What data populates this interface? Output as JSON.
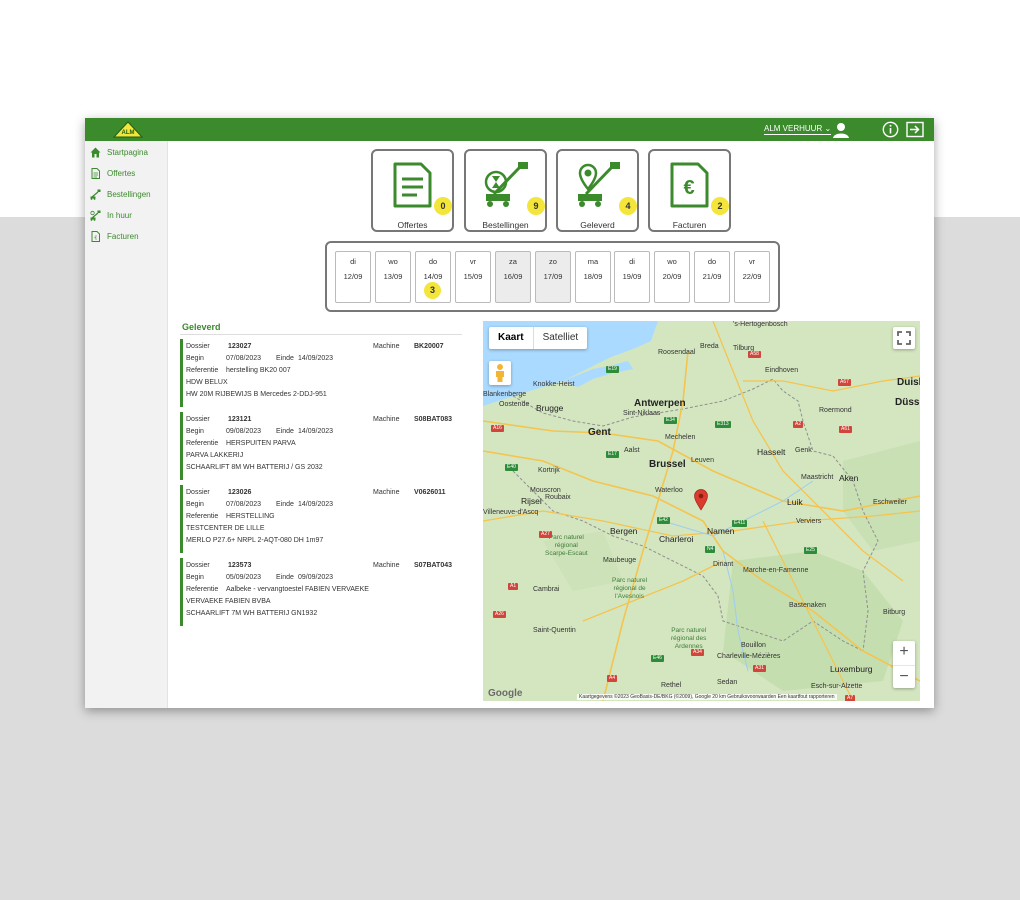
{
  "header": {
    "user_label": "ALM VERHUUR ⌄"
  },
  "sidebar": {
    "items": [
      {
        "label": "Startpagina",
        "icon": "home-icon"
      },
      {
        "label": "Offertes",
        "icon": "document-icon"
      },
      {
        "label": "Bestellingen",
        "icon": "lift-order-icon"
      },
      {
        "label": "In huur",
        "icon": "lift-rent-icon"
      },
      {
        "label": "Facturen",
        "icon": "invoice-icon"
      }
    ]
  },
  "tiles": [
    {
      "label": "Offertes",
      "count": "0",
      "icon": "document-icon"
    },
    {
      "label": "Bestellingen",
      "count": "9",
      "icon": "lift-hourglass-icon"
    },
    {
      "label": "Geleverd",
      "count": "4",
      "icon": "lift-pin-icon"
    },
    {
      "label": "Facturen",
      "count": "2",
      "icon": "euro-invoice-icon"
    }
  ],
  "calendar": [
    {
      "day": "di",
      "date": "12/09",
      "count": ""
    },
    {
      "day": "wo",
      "date": "13/09",
      "count": ""
    },
    {
      "day": "do",
      "date": "14/09",
      "count": "3"
    },
    {
      "day": "vr",
      "date": "15/09",
      "count": ""
    },
    {
      "day": "za",
      "date": "16/09",
      "count": ""
    },
    {
      "day": "zo",
      "date": "17/09",
      "count": ""
    },
    {
      "day": "ma",
      "date": "18/09",
      "count": ""
    },
    {
      "day": "di",
      "date": "19/09",
      "count": ""
    },
    {
      "day": "wo",
      "date": "20/09",
      "count": ""
    },
    {
      "day": "do",
      "date": "21/09",
      "count": ""
    },
    {
      "day": "vr",
      "date": "22/09",
      "count": ""
    }
  ],
  "list": {
    "title": "Geleverd",
    "labels": {
      "dossier": "Dossier",
      "begin": "Begin",
      "einde": "Einde",
      "referentie": "Referentie",
      "machine": "Machine"
    },
    "entries": [
      {
        "dossier": "123027",
        "machine": "BK20007",
        "begin": "07/08/2023",
        "einde": "14/09/2023",
        "referentie": "herstelling BK20 007",
        "klant": "HDW BELUX",
        "omschrijving": "HW 20M RIJBEWIJS B Mercedes 2-DDJ-951"
      },
      {
        "dossier": "123121",
        "machine": "S08BAT083",
        "begin": "09/08/2023",
        "einde": "14/09/2023",
        "referentie": "HERSPUITEN PARVA",
        "klant": "PARVA LAKKERIJ",
        "omschrijving": "SCHAARLIFT 8M WH BATTERIJ / GS 2032"
      },
      {
        "dossier": "123026",
        "machine": "V0626011",
        "begin": "07/08/2023",
        "einde": "14/09/2023",
        "referentie": "HERSTELLING",
        "klant": "TESTCENTER DE LILLE",
        "omschrijving": "MERLO P27.6+ NRPL 2-AQT-080 DH 1m97"
      },
      {
        "dossier": "123573",
        "machine": "S07BAT043",
        "begin": "05/09/2023",
        "einde": "09/09/2023",
        "referentie": "Aalbeke - vervangtoestel FABIEN VERVAEKE",
        "klant": "VERVAEKE FABIEN BVBA",
        "omschrijving": "SCHAARLIFT 7M WH BATTERIJ GN1932"
      }
    ]
  },
  "map": {
    "type_kaart": "Kaart",
    "type_satelliet": "Satelliet",
    "zoom_in": "+",
    "zoom_out": "−",
    "google": "Google",
    "attribution": "Kaartgegevens ©2023 GeoBasis-DE/BKG (©2009), Google    20 km             Gebruiksvoorwaarden    Een kaartfout rapporteren",
    "cities": {
      "hertogenbosch": "'s-Hertogenbosch",
      "breda": "Breda",
      "tilburg": "Tilburg",
      "roosendaal": "Roosendaal",
      "eindhoven": "Eindhoven",
      "duisb": "Duisb",
      "dusse": "Düsse",
      "knokke": "Knokke-Heist",
      "blankenberge": "Blankenberge",
      "oostende": "Oostende",
      "brugge": "Brugge",
      "antwerpen": "Antwerpen",
      "sintniklaas": "Sint-Niklaas",
      "roermond": "Roermond",
      "gent": "Gent",
      "mechelen": "Mechelen",
      "aalst": "Aalst",
      "hasselt": "Hasselt",
      "genk": "Genk",
      "brussel": "Brussel",
      "leuven": "Leuven",
      "kortrijk": "Kortrijk",
      "maastricht": "Maastricht",
      "rijsel": "Rijsel",
      "roubaix": "Roubaix",
      "mouscron": "Mouscron",
      "waterloo": "Waterloo",
      "luik": "Luik",
      "aken": "Aken",
      "villeneuve": "Villeneuve-d'Ascq",
      "verviers": "Verviers",
      "eschweiler": "Eschweiler",
      "bergen": "Bergen",
      "charleroi": "Charleroi",
      "namen": "Namen",
      "maubeuge": "Maubeuge",
      "dinant": "Dinant",
      "marche": "Marche-en-Famenne",
      "cambrai": "Cambrai",
      "bastenaken": "Bastenaken",
      "bitburg": "Bitburg",
      "saintquentin": "Saint-Quentin",
      "bouillon": "Bouillon",
      "luxemburg": "Luxemburg",
      "sedan": "Sedan",
      "esch": "Esch-sur-Alzette",
      "charleville": "Charleville-Mézières",
      "rethel": "Rethel"
    },
    "parks": {
      "scarpe": "Parc naturel\nrégional\nScarpe-Escaut",
      "avesnois": "Parc naturel\nrégional de\nl'Avesnois",
      "ardennes": "Parc naturel\nrégional des\nArdennes"
    },
    "highways": [
      "E19",
      "A58",
      "A67",
      "A2",
      "E34",
      "E313",
      "E17",
      "E40",
      "A16",
      "A27",
      "E42",
      "N4",
      "E411",
      "A1",
      "A26",
      "A4",
      "E25",
      "A61",
      "A31",
      "A34",
      "E46",
      "A7"
    ]
  },
  "colors": {
    "brand_green": "#3b8a2c",
    "badge_yellow": "#f3e53a",
    "map_pin": "#d93b2e"
  }
}
